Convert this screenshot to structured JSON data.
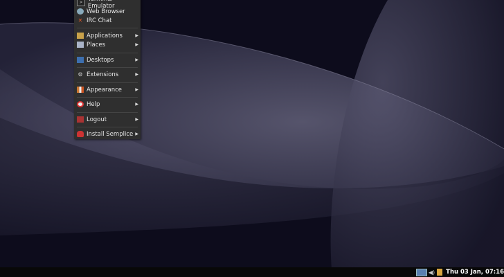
{
  "menu": {
    "items": [
      {
        "label": "Terminal Emulator",
        "icon": "terminal-icon",
        "submenu": false
      },
      {
        "label": "Web Browser",
        "icon": "globe-icon",
        "submenu": false
      },
      {
        "label": "IRC Chat",
        "icon": "irc-icon",
        "submenu": false
      },
      {
        "label": "Applications",
        "icon": "applications-icon",
        "submenu": true
      },
      {
        "label": "Places",
        "icon": "places-icon",
        "submenu": true
      },
      {
        "label": "Desktops",
        "icon": "desktops-icon",
        "submenu": true
      },
      {
        "label": "Extensions",
        "icon": "extensions-icon",
        "submenu": true
      },
      {
        "label": "Appearance",
        "icon": "appearance-icon",
        "submenu": true
      },
      {
        "label": "Help",
        "icon": "help-icon",
        "submenu": true
      },
      {
        "label": "Logout",
        "icon": "logout-icon",
        "submenu": true
      },
      {
        "label": "Install Semplice",
        "icon": "install-icon",
        "submenu": true
      }
    ],
    "arrow": "▶"
  },
  "panel": {
    "clock": "Thu 03 Jan, 07:16"
  },
  "colors": {
    "desktop": "#0d0c1c",
    "menu": "#2f2f2f",
    "panel": "#080808"
  }
}
